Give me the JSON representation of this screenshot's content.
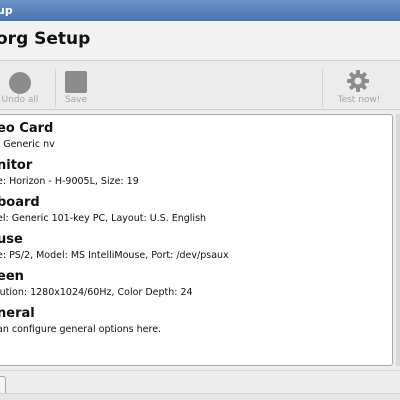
{
  "window": {
    "title": "up"
  },
  "header": {
    "title": "org Setup"
  },
  "toolbar": {
    "undo_all_label": "Undo all",
    "save_label": "Save",
    "test_now_label": "Test now!"
  },
  "items": [
    {
      "title": "eo Card",
      "detail": ": Generic nv"
    },
    {
      "title": "nitor",
      "detail": "e: Horizon - H-9005L, Size: 19"
    },
    {
      "title": "board",
      "detail": "el: Generic 101-key PC, Layout: U.S. English"
    },
    {
      "title": "use",
      "detail": "e: PS/2, Model: MS IntelliMouse, Port: /dev/psaux"
    },
    {
      "title": "een",
      "detail": "lution: 1280x1024/60Hz, Color Depth: 24"
    },
    {
      "title": "neral",
      "detail": "an configure general options here."
    }
  ]
}
